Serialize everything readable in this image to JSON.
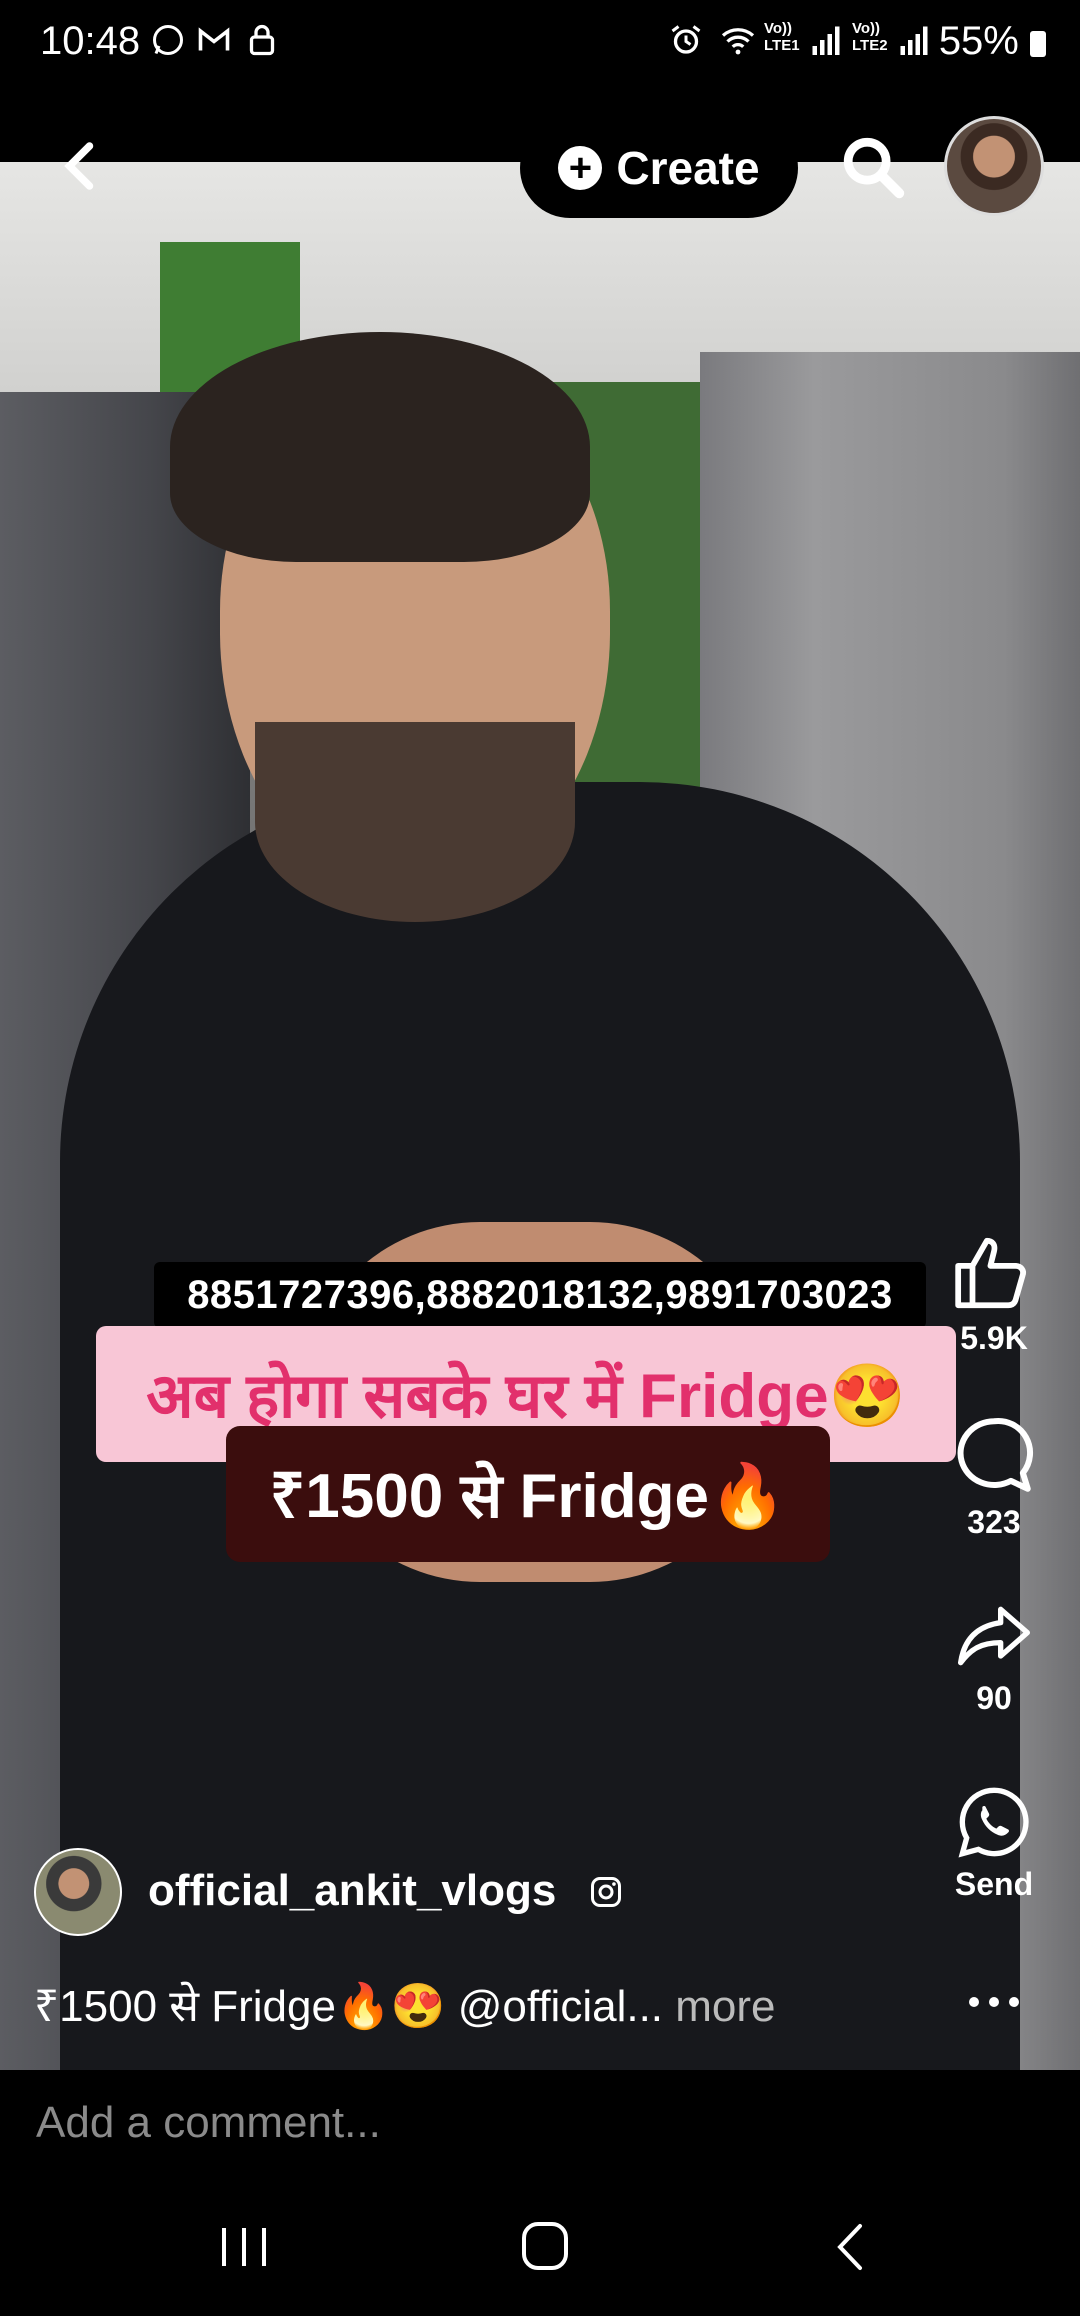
{
  "status_bar": {
    "time": "10:48",
    "net1": "Vo))\nLTE1",
    "net2": "Vo))\nLTE2",
    "battery": "55%"
  },
  "top_bar": {
    "create_label": "Create"
  },
  "overlay": {
    "phones": "8851727396,8882018132,9891703023",
    "headline": "अब होगा सबके घर में Fridge😍",
    "price": "₹1500 से Fridge🔥"
  },
  "actions": {
    "likes": "5.9K",
    "comments": "323",
    "shares": "90",
    "send_label": "Send"
  },
  "author": {
    "username": "official_ankit_vlogs"
  },
  "caption": {
    "text": "₹1500 से Fridge🔥😍 @official...",
    "more": " more"
  },
  "comment_box": {
    "placeholder": "Add a comment..."
  }
}
